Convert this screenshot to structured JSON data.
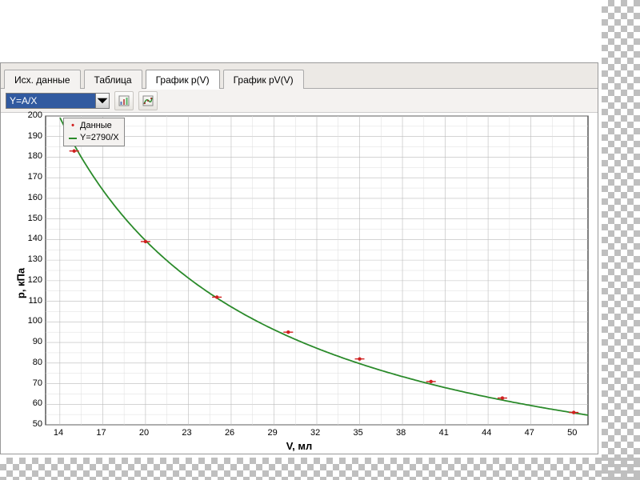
{
  "tabs": {
    "items": [
      {
        "label": "Исх. данные",
        "active": false
      },
      {
        "label": "Таблица",
        "active": false
      },
      {
        "label": "График p(V)",
        "active": true
      },
      {
        "label": "График pV(V)",
        "active": false
      }
    ]
  },
  "toolbar": {
    "fit_select_value": "Y=A/X"
  },
  "legend": {
    "data_label": "Данные",
    "fit_label": "Y=2790/X"
  },
  "axes": {
    "xlabel": "V, мл",
    "ylabel": "p, кПа"
  },
  "chart_data": {
    "type": "scatter",
    "title": "",
    "xlabel": "V, мл",
    "ylabel": "p, кПа",
    "xlim": [
      13,
      51
    ],
    "ylim": [
      50,
      200
    ],
    "xticks": [
      14,
      17,
      20,
      23,
      26,
      29,
      32,
      35,
      38,
      41,
      44,
      47,
      50
    ],
    "yticks": [
      50,
      60,
      70,
      80,
      90,
      100,
      110,
      120,
      130,
      140,
      150,
      160,
      170,
      180,
      190,
      200
    ],
    "series": [
      {
        "name": "Данные",
        "kind": "points",
        "color": "#d02020",
        "x": [
          15,
          20,
          25,
          30,
          35,
          40,
          45,
          50
        ],
        "values": [
          183,
          139,
          112,
          95,
          82,
          71,
          63,
          56
        ]
      },
      {
        "name": "Y=2790/X",
        "kind": "curve",
        "color": "#2a8a2a",
        "formula": "2790/x",
        "A": 2790
      }
    ]
  }
}
